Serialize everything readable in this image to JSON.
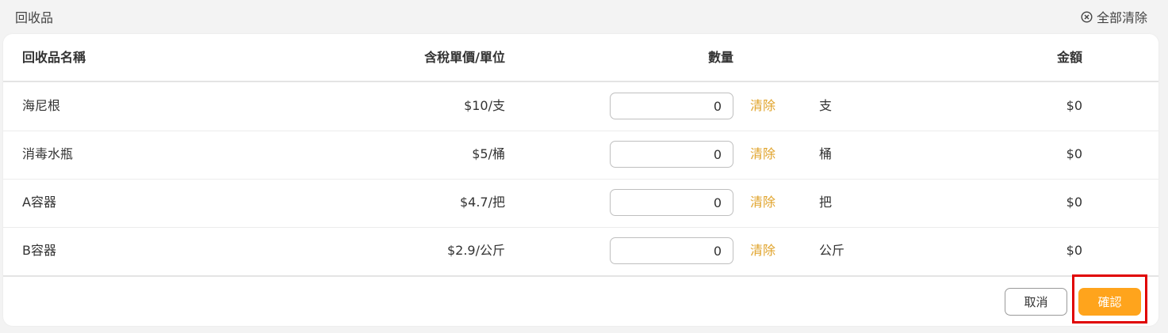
{
  "header": {
    "title": "回收品",
    "clear_all_label": "全部清除",
    "clear_all_icon": "close-circle-icon"
  },
  "table": {
    "columns": {
      "name": "回收品名稱",
      "price": "含稅單價/單位",
      "quantity": "數量",
      "amount": "金額"
    },
    "rows": [
      {
        "name": "海尼根",
        "price": "$10/支",
        "quantity": "0",
        "clear_label": "清除",
        "unit": "支",
        "amount": "$0"
      },
      {
        "name": "消毒水瓶",
        "price": "$5/桶",
        "quantity": "0",
        "clear_label": "清除",
        "unit": "桶",
        "amount": "$0"
      },
      {
        "name": "A容器",
        "price": "$4.7/把",
        "quantity": "0",
        "clear_label": "清除",
        "unit": "把",
        "amount": "$0"
      },
      {
        "name": "B容器",
        "price": "$2.9/公斤",
        "quantity": "0",
        "clear_label": "清除",
        "unit": "公斤",
        "amount": "$0"
      }
    ]
  },
  "footer": {
    "cancel_label": "取消",
    "confirm_label": "確認"
  },
  "colors": {
    "accent": "#ffa41c",
    "clear_link": "#e0a32a",
    "highlight": "#e00000",
    "background": "#f3f3f3"
  }
}
